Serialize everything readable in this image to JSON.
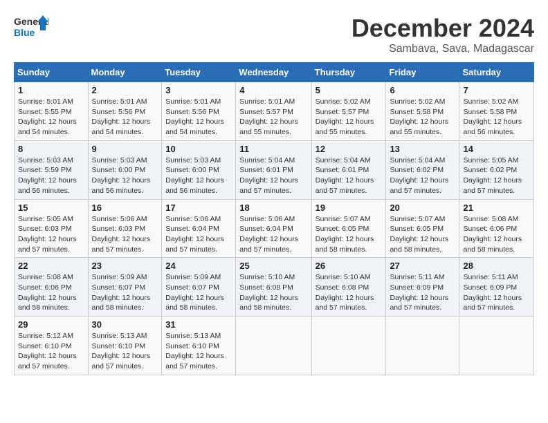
{
  "logo": {
    "line1": "General",
    "line2": "Blue"
  },
  "title": "December 2024",
  "location": "Sambava, Sava, Madagascar",
  "days_header": [
    "Sunday",
    "Monday",
    "Tuesday",
    "Wednesday",
    "Thursday",
    "Friday",
    "Saturday"
  ],
  "weeks": [
    [
      {
        "day": "1",
        "sunrise": "5:01 AM",
        "sunset": "5:55 PM",
        "daylight": "12 hours and 54 minutes."
      },
      {
        "day": "2",
        "sunrise": "5:01 AM",
        "sunset": "5:56 PM",
        "daylight": "12 hours and 54 minutes."
      },
      {
        "day": "3",
        "sunrise": "5:01 AM",
        "sunset": "5:56 PM",
        "daylight": "12 hours and 54 minutes."
      },
      {
        "day": "4",
        "sunrise": "5:01 AM",
        "sunset": "5:57 PM",
        "daylight": "12 hours and 55 minutes."
      },
      {
        "day": "5",
        "sunrise": "5:02 AM",
        "sunset": "5:57 PM",
        "daylight": "12 hours and 55 minutes."
      },
      {
        "day": "6",
        "sunrise": "5:02 AM",
        "sunset": "5:58 PM",
        "daylight": "12 hours and 55 minutes."
      },
      {
        "day": "7",
        "sunrise": "5:02 AM",
        "sunset": "5:58 PM",
        "daylight": "12 hours and 56 minutes."
      }
    ],
    [
      {
        "day": "8",
        "sunrise": "5:03 AM",
        "sunset": "5:59 PM",
        "daylight": "12 hours and 56 minutes."
      },
      {
        "day": "9",
        "sunrise": "5:03 AM",
        "sunset": "6:00 PM",
        "daylight": "12 hours and 56 minutes."
      },
      {
        "day": "10",
        "sunrise": "5:03 AM",
        "sunset": "6:00 PM",
        "daylight": "12 hours and 56 minutes."
      },
      {
        "day": "11",
        "sunrise": "5:04 AM",
        "sunset": "6:01 PM",
        "daylight": "12 hours and 57 minutes."
      },
      {
        "day": "12",
        "sunrise": "5:04 AM",
        "sunset": "6:01 PM",
        "daylight": "12 hours and 57 minutes."
      },
      {
        "day": "13",
        "sunrise": "5:04 AM",
        "sunset": "6:02 PM",
        "daylight": "12 hours and 57 minutes."
      },
      {
        "day": "14",
        "sunrise": "5:05 AM",
        "sunset": "6:02 PM",
        "daylight": "12 hours and 57 minutes."
      }
    ],
    [
      {
        "day": "15",
        "sunrise": "5:05 AM",
        "sunset": "6:03 PM",
        "daylight": "12 hours and 57 minutes."
      },
      {
        "day": "16",
        "sunrise": "5:06 AM",
        "sunset": "6:03 PM",
        "daylight": "12 hours and 57 minutes."
      },
      {
        "day": "17",
        "sunrise": "5:06 AM",
        "sunset": "6:04 PM",
        "daylight": "12 hours and 57 minutes."
      },
      {
        "day": "18",
        "sunrise": "5:06 AM",
        "sunset": "6:04 PM",
        "daylight": "12 hours and 57 minutes."
      },
      {
        "day": "19",
        "sunrise": "5:07 AM",
        "sunset": "6:05 PM",
        "daylight": "12 hours and 58 minutes."
      },
      {
        "day": "20",
        "sunrise": "5:07 AM",
        "sunset": "6:05 PM",
        "daylight": "12 hours and 58 minutes."
      },
      {
        "day": "21",
        "sunrise": "5:08 AM",
        "sunset": "6:06 PM",
        "daylight": "12 hours and 58 minutes."
      }
    ],
    [
      {
        "day": "22",
        "sunrise": "5:08 AM",
        "sunset": "6:06 PM",
        "daylight": "12 hours and 58 minutes."
      },
      {
        "day": "23",
        "sunrise": "5:09 AM",
        "sunset": "6:07 PM",
        "daylight": "12 hours and 58 minutes."
      },
      {
        "day": "24",
        "sunrise": "5:09 AM",
        "sunset": "6:07 PM",
        "daylight": "12 hours and 58 minutes."
      },
      {
        "day": "25",
        "sunrise": "5:10 AM",
        "sunset": "6:08 PM",
        "daylight": "12 hours and 58 minutes."
      },
      {
        "day": "26",
        "sunrise": "5:10 AM",
        "sunset": "6:08 PM",
        "daylight": "12 hours and 57 minutes."
      },
      {
        "day": "27",
        "sunrise": "5:11 AM",
        "sunset": "6:09 PM",
        "daylight": "12 hours and 57 minutes."
      },
      {
        "day": "28",
        "sunrise": "5:11 AM",
        "sunset": "6:09 PM",
        "daylight": "12 hours and 57 minutes."
      }
    ],
    [
      {
        "day": "29",
        "sunrise": "5:12 AM",
        "sunset": "6:10 PM",
        "daylight": "12 hours and 57 minutes."
      },
      {
        "day": "30",
        "sunrise": "5:13 AM",
        "sunset": "6:10 PM",
        "daylight": "12 hours and 57 minutes."
      },
      {
        "day": "31",
        "sunrise": "5:13 AM",
        "sunset": "6:10 PM",
        "daylight": "12 hours and 57 minutes."
      },
      null,
      null,
      null,
      null
    ]
  ]
}
